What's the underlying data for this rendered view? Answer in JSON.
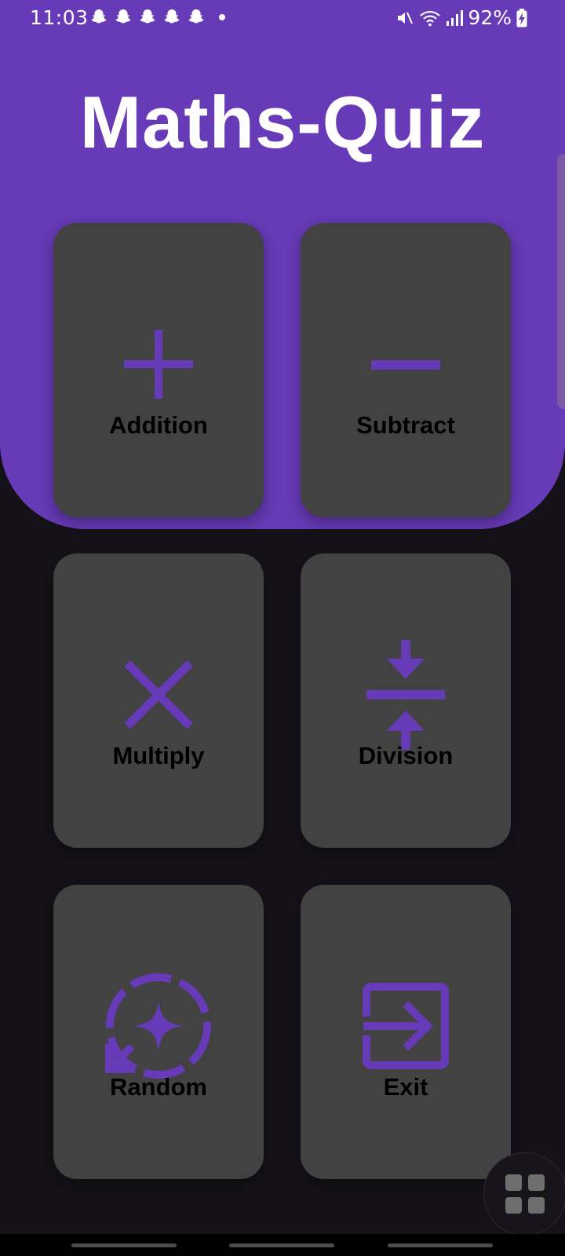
{
  "status_bar": {
    "time": "11:03",
    "battery": "92%",
    "notification_icons": [
      "snapchat-icon",
      "snapchat-icon",
      "snapchat-icon",
      "snapchat-icon",
      "snapchat-icon",
      "dot-icon"
    ],
    "system_icons": [
      "mute-icon",
      "wifi-icon",
      "signal-icon",
      "battery-charging-icon"
    ]
  },
  "header": {
    "title": "Maths-Quiz"
  },
  "colors": {
    "accent": "#673AB7",
    "card": "#424242",
    "background": "#141218",
    "label": "#000000"
  },
  "cards": [
    {
      "label": "Addition",
      "icon": "plus-icon"
    },
    {
      "label": "Subtract",
      "icon": "minus-icon"
    },
    {
      "label": "Multiply",
      "icon": "multiply-icon"
    },
    {
      "label": "Division",
      "icon": "compress-icon"
    },
    {
      "label": "Random",
      "icon": "sync-sparkle-icon"
    },
    {
      "label": "Exit",
      "icon": "exit-icon"
    }
  ],
  "fab": {
    "icon": "grid-icon"
  }
}
